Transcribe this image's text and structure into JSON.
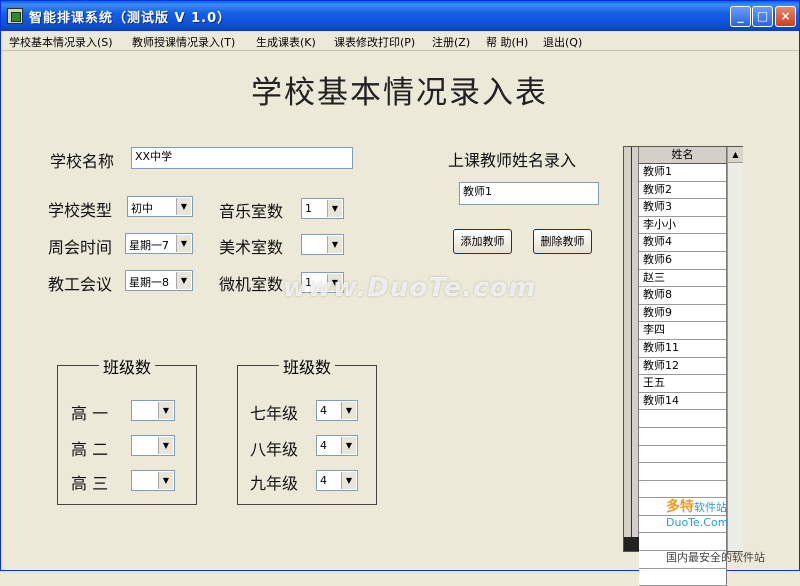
{
  "window": {
    "title": "智能排课系统（测试版 V 1.0）",
    "min_glyph": "_",
    "max_glyph": "□",
    "close_glyph": "×"
  },
  "menu": [
    "学校基本情况录入(S)",
    "教师授课情况录入(T)",
    "生成课表(K)",
    "课表修改打印(P)",
    "注册(Z)",
    "帮 助(H)",
    "退出(Q)"
  ],
  "form": {
    "heading": "学校基本情况录入表",
    "school_name_label": "学校名称",
    "school_name_value": "XX中学",
    "school_type_label": "学校类型",
    "school_type_value": "初中",
    "weekly_meeting_label": "周会时间",
    "weekly_meeting_value": "星期一7",
    "staff_meeting_label": "教工会议",
    "staff_meeting_value": "星期一8",
    "music_rooms_label": "音乐室数",
    "music_rooms_value": "1",
    "art_rooms_label": "美术室数",
    "art_rooms_value": "",
    "computer_rooms_label": "微机室数",
    "computer_rooms_value": "1"
  },
  "high_school_group": {
    "title": "班级数",
    "grades": [
      {
        "label": "高 一",
        "value": ""
      },
      {
        "label": "高 二",
        "value": ""
      },
      {
        "label": "高 三",
        "value": ""
      }
    ]
  },
  "middle_school_group": {
    "title": "班级数",
    "grades": [
      {
        "label": "七年级",
        "value": "4"
      },
      {
        "label": "八年级",
        "value": "4"
      },
      {
        "label": "九年级",
        "value": "4"
      }
    ]
  },
  "teacher_entry": {
    "label": "上课教师姓名录入",
    "input_value": "教师1",
    "add_button": "添加教师",
    "delete_button": "删除教师"
  },
  "teacher_table": {
    "header": "姓名",
    "rows": [
      "教师1",
      "教师2",
      "教师3",
      "李小小",
      "教师4",
      "教师6",
      "赵三",
      "教师8",
      "教师9",
      "李四",
      "教师11",
      "教师12",
      "王五",
      "教师14",
      "",
      "",
      "",
      "",
      "",
      "",
      "",
      "",
      "",
      ""
    ]
  },
  "icons": {
    "dropdown": "▼",
    "scroll_up": "▲"
  },
  "watermarks": {
    "center": "www.DuoTe.com",
    "corner_brand": "多特",
    "corner_brand_suffix": "软件站",
    "corner_url": "DuoTe.Com",
    "corner_slogan": "国内最安全的软件站"
  }
}
